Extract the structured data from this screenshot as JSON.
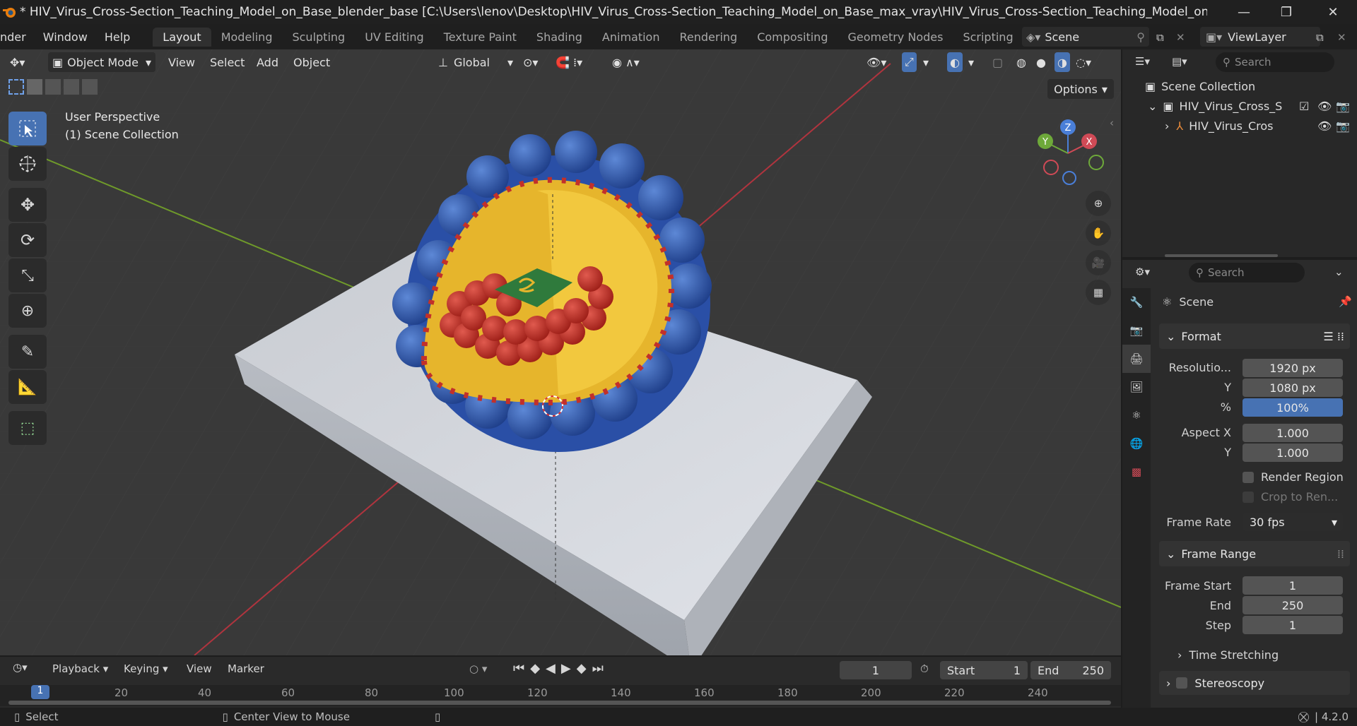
{
  "window": {
    "title": "* HIV_Virus_Cross-Section_Teaching_Model_on_Base_blender_base [C:\\Users\\lenov\\Desktop\\HIV_Virus_Cross-Section_Teaching_Model_on_Base_max_vray\\HIV_Virus_Cross-Section_Teaching_Model_on_Base_blender_base.blen..."
  },
  "menu": {
    "items": [
      "nder",
      "Window",
      "Help"
    ]
  },
  "workspaces": {
    "tabs": [
      "Layout",
      "Modeling",
      "Sculpting",
      "UV Editing",
      "Texture Paint",
      "Shading",
      "Animation",
      "Rendering",
      "Compositing",
      "Geometry Nodes",
      "Scripting"
    ],
    "active": "Layout",
    "add": "+"
  },
  "scene": {
    "name": "Scene",
    "view_layer": "ViewLayer"
  },
  "viewport": {
    "mode": "Object Mode",
    "menus": [
      "View",
      "Select",
      "Add",
      "Object"
    ],
    "orientation": "Global",
    "options_label": "Options",
    "hud_line1": "User Perspective",
    "hud_line2": "(1) Scene Collection",
    "gizmo": {
      "x": "X",
      "y": "Y",
      "z": "Z"
    }
  },
  "timeline": {
    "menus": [
      "Playback",
      "Keying",
      "View",
      "Marker"
    ],
    "current_frame": "1",
    "start_label": "Start",
    "start": "1",
    "end_label": "End",
    "end": "250",
    "ruler": [
      "1",
      "20",
      "40",
      "60",
      "80",
      "100",
      "120",
      "140",
      "160",
      "180",
      "200",
      "220",
      "240"
    ]
  },
  "status": {
    "select": "Select",
    "center_view": "Center View to Mouse",
    "version": "4.2.0"
  },
  "outliner": {
    "search_placeholder": "Search",
    "root": "Scene Collection",
    "collection": "HIV_Virus_Cross_S",
    "object": "HIV_Virus_Cros"
  },
  "properties": {
    "search_placeholder": "Search",
    "context": "Scene",
    "format": {
      "header": "Format",
      "resolution_label": "Resolutio...",
      "res_x": "1920 px",
      "y_label": "Y",
      "res_y": "1080 px",
      "pct_label": "%",
      "pct": "100%",
      "aspect_x_label": "Aspect X",
      "aspect_x": "1.000",
      "aspect_y_label": "Y",
      "aspect_y": "1.000",
      "render_region": "Render Region",
      "crop": "Crop to Ren...",
      "frame_rate_label": "Frame Rate",
      "frame_rate": "30 fps"
    },
    "frame_range": {
      "header": "Frame Range",
      "start_label": "Frame Start",
      "start": "1",
      "end_label": "End",
      "end": "250",
      "step_label": "Step",
      "step": "1",
      "time_stretching": "Time Stretching"
    },
    "stereoscopy": "Stereoscopy"
  }
}
